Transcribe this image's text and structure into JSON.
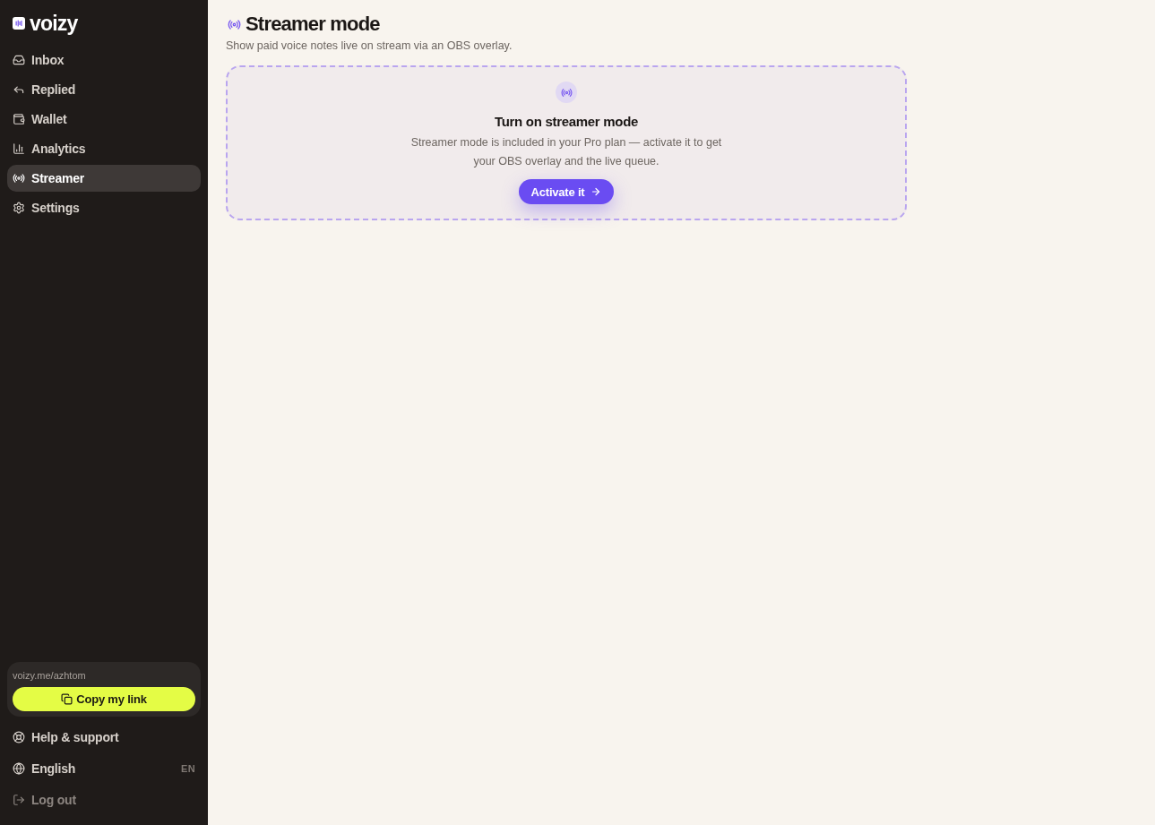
{
  "sidebar": {
    "logo": "voizy",
    "nav": [
      {
        "label": "Inbox",
        "selected": false
      },
      {
        "label": "Replied",
        "selected": false
      },
      {
        "label": "Wallet",
        "selected": false
      },
      {
        "label": "Analytics",
        "selected": false
      },
      {
        "label": "Streamer",
        "selected": true
      },
      {
        "label": "Settings",
        "selected": false
      }
    ],
    "link_card": {
      "url": "voizy.me/azhtom",
      "button": "Copy my link"
    },
    "footer": [
      {
        "kind": "link",
        "label": "Help & support"
      },
      {
        "kind": "language",
        "label": "English",
        "code": "EN"
      },
      {
        "kind": "logout",
        "label": "Log out"
      }
    ]
  },
  "page": {
    "title": "Streamer mode",
    "subtitle": "Show paid voice notes live on stream via an OBS overlay."
  },
  "activation_card": {
    "title": "Turn on streamer mode",
    "description": "Streamer mode is included in your Pro plan — activate it to get your OBS overlay and the live queue.",
    "button": "Activate it"
  }
}
